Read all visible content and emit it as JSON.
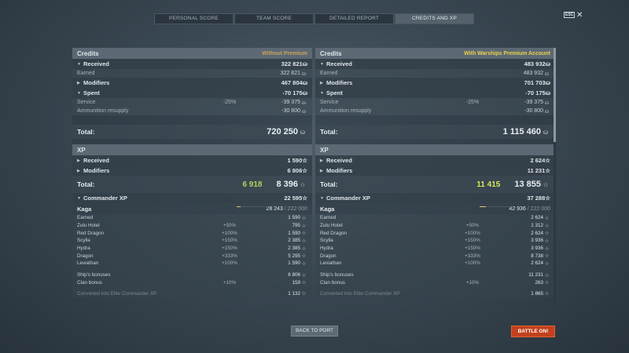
{
  "tabs": [
    "PERSONAL SCORE",
    "TEAM SCORE",
    "DETAILED REPORT",
    "CREDITS AND XP"
  ],
  "esc_label": "ESC",
  "left": {
    "credits_header": "Credits",
    "credits_sub": "Without Premium",
    "received": {
      "label": "Received",
      "value": "322 821"
    },
    "earned": {
      "label": "Earned",
      "value": "322 821"
    },
    "modifiers": {
      "label": "Modifiers",
      "value": "467 804"
    },
    "spent": {
      "label": "Spent",
      "value": "-70 175"
    },
    "service": {
      "label": "Service",
      "pct": "-25%",
      "value": "-39 375"
    },
    "ammo": {
      "label": "Ammunition resupply",
      "value": "-30 800"
    },
    "total_label": "Total:",
    "credits_total": "720 250",
    "xp_header": "XP",
    "xp_received": {
      "label": "Received",
      "value": "1 590"
    },
    "xp_modifiers": {
      "label": "Modifiers",
      "value": "6 806"
    },
    "xp_total_green": "6 918",
    "xp_total": "8 396",
    "commander": {
      "label": "Commander XP",
      "value": "22 595"
    },
    "cmd_name": "Kaga",
    "cmd_progress": "28 243",
    "cmd_max": "/ 222 000",
    "list": [
      {
        "label": "Earned",
        "pct": "",
        "value": "1 590"
      },
      {
        "label": "Zulu Hotel",
        "pct": "+50%",
        "value": "795"
      },
      {
        "label": "Red Dragon",
        "pct": "+100%",
        "value": "1 590"
      },
      {
        "label": "Scylla",
        "pct": "+150%",
        "value": "2 385"
      },
      {
        "label": "Hydra",
        "pct": "+150%",
        "value": "2 385"
      },
      {
        "label": "Dragon",
        "pct": "+333%",
        "value": "5 295"
      },
      {
        "label": "Leviathan",
        "pct": "+100%",
        "value": "1 590"
      }
    ],
    "bonuses": [
      {
        "label": "Ship's bonuses",
        "pct": "",
        "value": "6 806"
      },
      {
        "label": "Clan bonus",
        "pct": "+10%",
        "value": "159"
      }
    ],
    "cut_label": "Converted into Elite Commander XP",
    "cut_value": "1 132"
  },
  "right": {
    "credits_header": "Credits",
    "credits_sub": "With Warships Premium Account",
    "received": {
      "label": "Received",
      "value": "483 932"
    },
    "earned": {
      "label": "Earned",
      "value": "483 932"
    },
    "modifiers": {
      "label": "Modifiers",
      "value": "701 703"
    },
    "spent": {
      "label": "Spent",
      "value": "-70 175"
    },
    "service": {
      "label": "Service",
      "pct": "-25%",
      "value": "-39 375"
    },
    "ammo": {
      "label": "Ammunition resupply",
      "value": "-30 800"
    },
    "total_label": "Total:",
    "credits_total": "1 115 460",
    "xp_header": "XP",
    "xp_received": {
      "label": "Received",
      "value": "2 624"
    },
    "xp_modifiers": {
      "label": "Modifiers",
      "value": "11 231"
    },
    "xp_total_green": "11 415",
    "xp_total": "13 855",
    "commander": {
      "label": "Commander XP",
      "value": "37 288"
    },
    "cmd_name": "Kaga",
    "cmd_progress": "42 936",
    "cmd_max": "/ 222 000",
    "list": [
      {
        "label": "Earned",
        "pct": "",
        "value": "2 624"
      },
      {
        "label": "Zulu Hotel",
        "pct": "+50%",
        "value": "1 312"
      },
      {
        "label": "Red Dragon",
        "pct": "+100%",
        "value": "2 624"
      },
      {
        "label": "Scylla",
        "pct": "+150%",
        "value": "3 936"
      },
      {
        "label": "Hydra",
        "pct": "+150%",
        "value": "3 936"
      },
      {
        "label": "Dragon",
        "pct": "+333%",
        "value": "8 738"
      },
      {
        "label": "Leviathan",
        "pct": "+100%",
        "value": "2 624"
      }
    ],
    "bonuses": [
      {
        "label": "Ship's bonuses",
        "pct": "",
        "value": "11 231"
      },
      {
        "label": "Clan bonus",
        "pct": "+10%",
        "value": "263"
      }
    ],
    "cut_label": "Converted into Elite Commander XP",
    "cut_value": "1 865"
  },
  "buttons": {
    "back": "BACK TO PORT",
    "battle": "BATTLE ON!"
  },
  "icons": {
    "credits": "credits-coin-icon",
    "xp": "xp-star-icon",
    "esc": "esc-icon",
    "close": "close-icon"
  },
  "colors": {
    "accent_premium": "#e8d24a",
    "green_total": "#b6cf5a",
    "battle_button": "#c2411c"
  }
}
